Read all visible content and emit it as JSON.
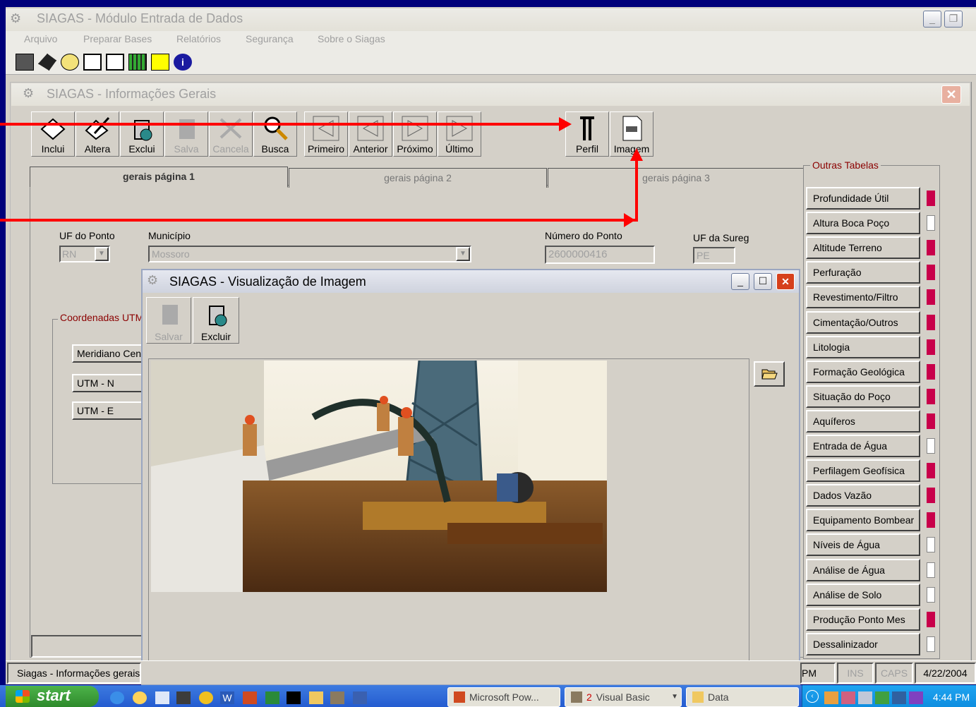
{
  "main_window": {
    "title": "SIAGAS  -  Módulo Entrada de Dados",
    "menu": [
      "Arquivo",
      "Preparar Bases",
      "Relatórios",
      "Segurança",
      "Sobre o Siagas"
    ]
  },
  "child_window": {
    "title": "SIAGAS  -  Informações Gerais",
    "toolbar": {
      "incluir": "Inclui",
      "alterar": "Altera",
      "excluir": "Exclui",
      "salvar": "Salva",
      "cancelar": "Cancela",
      "buscar": "Busca",
      "primeiro": "Primeiro",
      "anterior": "Anterior",
      "proximo": "Próximo",
      "ultimo": "Último",
      "perfil": "Perfil",
      "imagem": "Imagem"
    },
    "tabs": [
      "gerais página 1",
      "gerais página 2",
      "gerais página 3"
    ],
    "fields": {
      "uf_ponto_label": "UF do Ponto",
      "uf_ponto_value": "RN",
      "municipio_label": "Município",
      "municipio_value": "Mossoro",
      "numero_ponto_label": "Número do Ponto",
      "numero_ponto_value": "2600000416",
      "uf_sureg_label": "UF da Sureg",
      "uf_sureg_value": "PE"
    },
    "coords": {
      "group_label": "Coordenadas UTM",
      "meridiano": "Meridiano Central",
      "utm_n": "UTM - N",
      "utm_e": "UTM - E"
    },
    "outras_tabelas": {
      "label": "Outras Tabelas",
      "items": [
        {
          "label": "Profundidade Útil",
          "active": true
        },
        {
          "label": "Altura Boca Poço",
          "active": false
        },
        {
          "label": "Altitude Terreno",
          "active": true
        },
        {
          "label": "Perfuração",
          "active": true
        },
        {
          "label": "Revestimento/Filtro",
          "active": true
        },
        {
          "label": "Cimentação/Outros",
          "active": true
        },
        {
          "label": "Litologia",
          "active": true
        },
        {
          "label": "Formação Geológica",
          "active": true
        },
        {
          "label": "Situação do Poço",
          "active": true
        },
        {
          "label": "Aquíferos",
          "active": true
        },
        {
          "label": "Entrada de Água",
          "active": false
        },
        {
          "label": "Perfilagem Geofísica",
          "active": true
        },
        {
          "label": "Dados Vazão",
          "active": true
        },
        {
          "label": "Equipamento Bombear",
          "active": true
        },
        {
          "label": "Níveis de Água",
          "active": false
        },
        {
          "label": "Análise de Água",
          "active": false
        },
        {
          "label": "Análise de Solo",
          "active": false
        },
        {
          "label": "Produção Ponto Mes",
          "active": true
        },
        {
          "label": "Dessalinizador",
          "active": false
        }
      ]
    }
  },
  "image_window": {
    "title": "SIAGAS  -  Visualização de Imagem",
    "salvar": "Salvar",
    "excluir": "Excluir"
  },
  "status_bar": {
    "text": "Siagas  -  Informações gerais",
    "time_fragment": "PM",
    "ins": "INS",
    "caps": "CAPS",
    "date": "4/22/2004"
  },
  "taskbar": {
    "start": "start",
    "items": [
      "Microsoft Pow...",
      "Visual Basic",
      "Data"
    ],
    "vb_count": "2",
    "clock": "4:44 PM"
  },
  "colors": {
    "annotation_arrow": "#ff0000",
    "indicator_on": "#c8004a",
    "frame_label": "#8b0000"
  }
}
